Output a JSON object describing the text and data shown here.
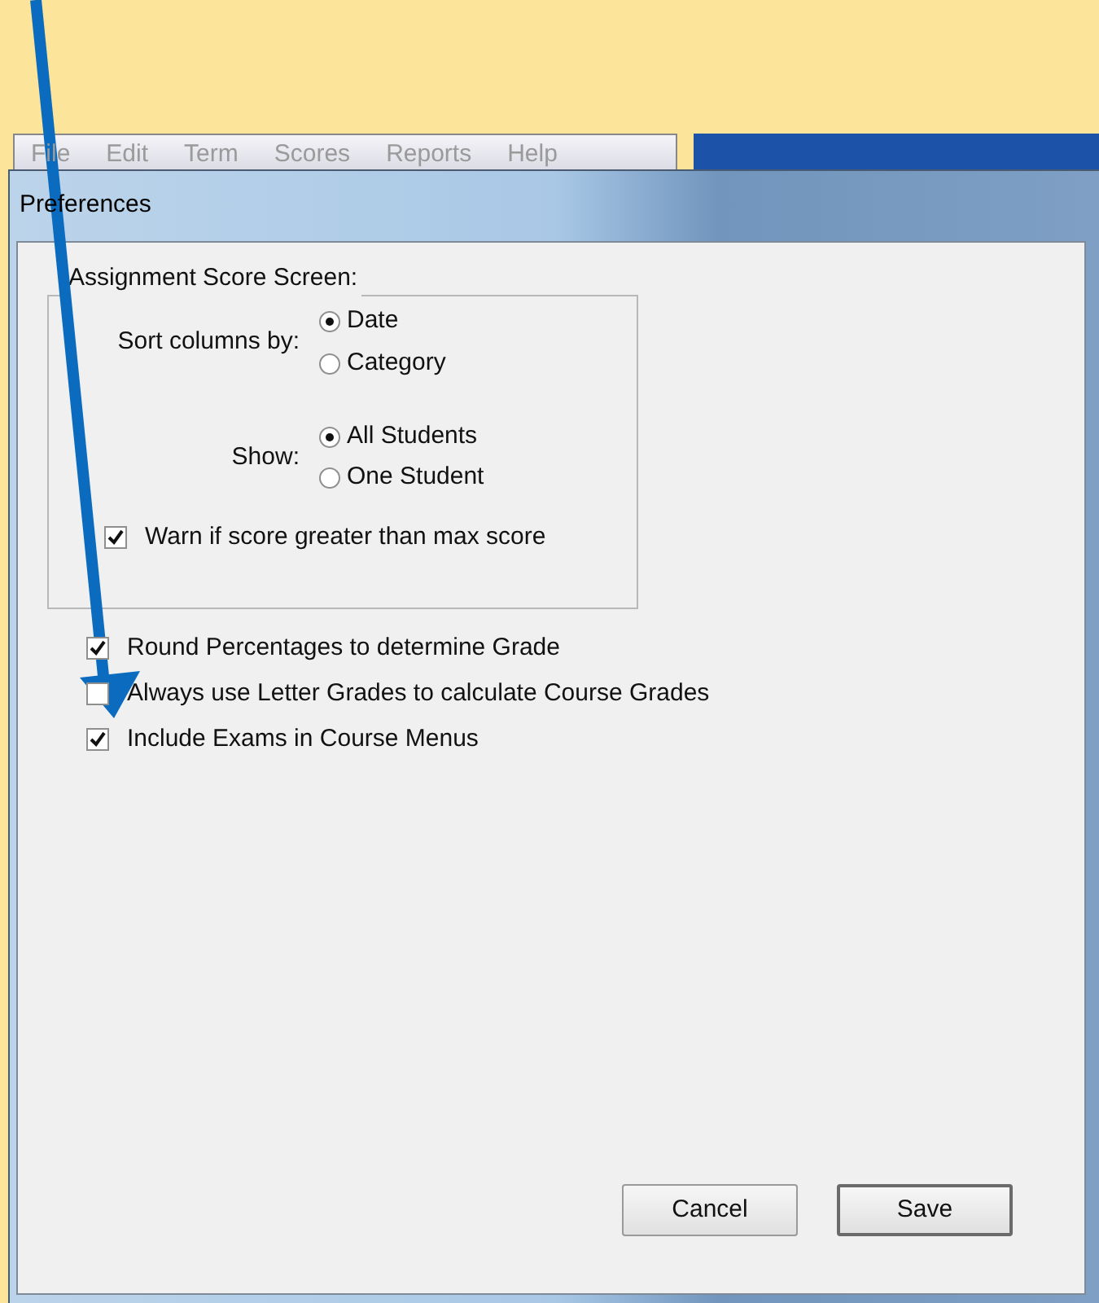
{
  "menu_bar": [
    "File",
    "Edit",
    "Term",
    "Scores",
    "Reports",
    "Help"
  ],
  "dialog": {
    "title": "Preferences"
  },
  "group": {
    "title": "Assignment Score Screen:",
    "radio_groups": [
      {
        "label": "Sort columns by:",
        "options": [
          {
            "label": "Date",
            "selected": true
          },
          {
            "label": "Category",
            "selected": false
          }
        ]
      },
      {
        "label": "Show:",
        "options": [
          {
            "label": "All Students",
            "selected": true
          },
          {
            "label": "One Student",
            "selected": false
          }
        ]
      }
    ],
    "checkbox": {
      "label": "Warn if score greater than max score",
      "checked": true
    }
  },
  "checkboxes": [
    {
      "label": "Round Percentages to determine Grade",
      "checked": true
    },
    {
      "label": "Always use Letter Grades to calculate Course Grades",
      "checked": false
    },
    {
      "label": "Include Exams in Course Menus",
      "checked": true
    }
  ],
  "buttons": [
    {
      "label": "Cancel",
      "default": false
    },
    {
      "label": "Save",
      "default": true
    }
  ]
}
